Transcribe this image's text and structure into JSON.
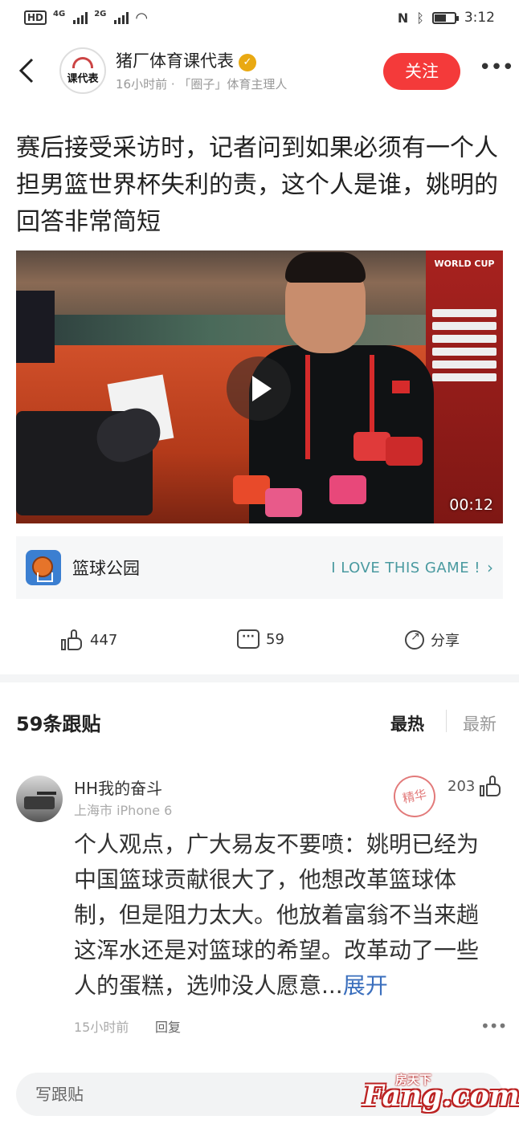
{
  "status_bar": {
    "hd": "HD",
    "net1": "4G",
    "net2": "2G",
    "time": "3:12",
    "battery_level": 0.6
  },
  "header": {
    "back_icon": "chevron-left-icon",
    "avatar_text": "课代表",
    "author_name": "猪厂体育课代表",
    "verified_icon": "verified-badge-icon",
    "meta": "16小时前 · 「圈子」体育主理人",
    "follow_label": "关注",
    "more_icon": "more-dots-icon"
  },
  "article": {
    "title": "赛后接受采访时，记者问到如果必须有一个人担男篮世界杯失利的责，这个人是谁，姚明的回答非常简短"
  },
  "video": {
    "duration": "00:12",
    "board_text": "WORLD CUP",
    "play_icon": "play-icon"
  },
  "channel": {
    "name": "篮球公园",
    "slogan": "I LOVE THIS GAME !",
    "chevron": "›"
  },
  "actions": {
    "likes": "447",
    "comments": "59",
    "share_label": "分享"
  },
  "comments_header": {
    "title": "59条跟贴",
    "sort_hot": "最热",
    "sort_new": "最新"
  },
  "comment": {
    "user": "HH我的奋斗",
    "meta": "上海市  iPhone 6",
    "stamp": "精华",
    "likes": "203",
    "text": "个人观点，广大易友不要喷：姚明已经为中国篮球贡献很大了，他想改革篮球体制，但是阻力太大。他放着富翁不当来趟这浑水还是对篮球的希望。改革动了一些人的蛋糕，选帅没人愿意...",
    "expand": "展开",
    "time": "15小时前",
    "reply": "回复"
  },
  "bottom": {
    "reply_placeholder": "写跟贴",
    "watermark_top": "房天下",
    "watermark_main": "Fang.com"
  },
  "colors": {
    "accent_red": "#f43a3a",
    "link_blue": "#3b6fbd",
    "slogan_teal": "#4a9aa0"
  }
}
